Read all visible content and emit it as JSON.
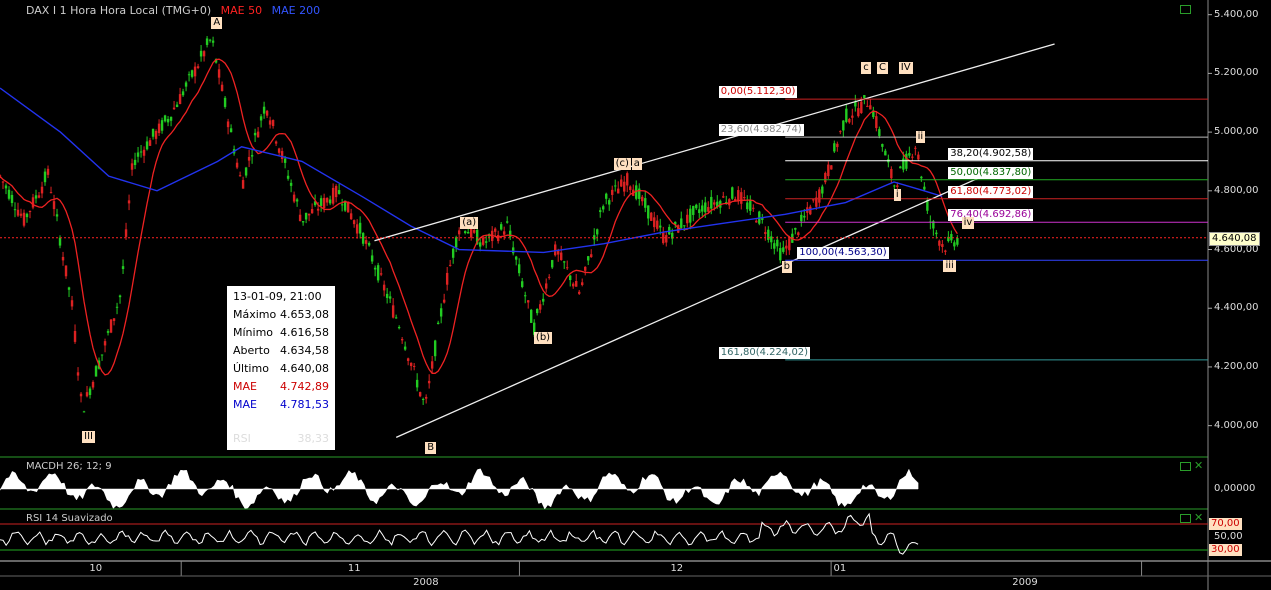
{
  "header": {
    "symbol_label": "DAX I 1 Hora Hora Local (TMG+0)",
    "mae50_label": "MAE 50",
    "mae200_label": "MAE 200",
    "colors": {
      "symbol": "#cccccc",
      "mae50": "#ff2222",
      "mae200": "#3355ff"
    }
  },
  "chart_data": {
    "type": "line",
    "main": {
      "yticks": [
        "5.400,00",
        "5.200,00",
        "5.000,00",
        "4.800,00",
        "4.600,00",
        "4.400,00",
        "4.200,00",
        "4.000,00"
      ],
      "ytick_values": [
        5400,
        5200,
        5000,
        4800,
        4600,
        4400,
        4200,
        4000
      ],
      "ylim": [
        3900,
        5450
      ],
      "last_price_label": "4.640,08",
      "last_price": 4640.08,
      "fibonacci": [
        {
          "label": "0,00(5.112,30)",
          "value": 5112.3,
          "color": "#cc2222",
          "text_bg": "#ffffff",
          "text_color": "#cc0000"
        },
        {
          "label": "23,60(4.982,74)",
          "value": 4982.74,
          "color": "#bbbbbb",
          "text_bg": "#ffffff",
          "text_color": "#888888"
        },
        {
          "label": "38,20(4.902,58)",
          "value": 4902.58,
          "color": "#ffffff",
          "text_bg": "#ffffff",
          "text_color": "#000000"
        },
        {
          "label": "50,00(4.837,80)",
          "value": 4837.8,
          "color": "#22aa22",
          "text_bg": "#ffffff",
          "text_color": "#006600"
        },
        {
          "label": "61,80(4.773,02)",
          "value": 4773.02,
          "color": "#cc2222",
          "text_bg": "#ffffff",
          "text_color": "#cc0000"
        },
        {
          "label": "76,40(4.692,86)",
          "value": 4692.86,
          "color": "#cc33cc",
          "text_bg": "#ffffff",
          "text_color": "#990099"
        },
        {
          "label": "100,00(4.563,30)",
          "value": 4563.3,
          "color": "#3344ff",
          "text_bg": "#ffffff",
          "text_color": "#000088"
        },
        {
          "label": "161,80(4.224,02)",
          "value": 4224.02,
          "color": "#339999",
          "text_bg": "#ffffff",
          "text_color": "#336666"
        }
      ],
      "wave_labels": [
        {
          "text": "A",
          "x": 0.175,
          "value": 5370
        },
        {
          "text": "III",
          "x": 0.068,
          "value": 3960
        },
        {
          "text": "B",
          "x": 0.352,
          "value": 3925
        },
        {
          "text": "(a)",
          "x": 0.381,
          "value": 4690
        },
        {
          "text": "(b)",
          "x": 0.442,
          "value": 4300
        },
        {
          "text": "(c)",
          "x": 0.508,
          "value": 4890
        },
        {
          "text": "a",
          "x": 0.523,
          "value": 4890
        },
        {
          "text": "b",
          "x": 0.647,
          "value": 4540
        },
        {
          "text": "c",
          "x": 0.713,
          "value": 5220
        },
        {
          "text": "C",
          "x": 0.726,
          "value": 5220
        },
        {
          "text": "IV",
          "x": 0.744,
          "value": 5220
        },
        {
          "text": "i",
          "x": 0.74,
          "value": 4785
        },
        {
          "text": "ii",
          "x": 0.758,
          "value": 4985
        },
        {
          "text": "iii",
          "x": 0.781,
          "value": 4545
        },
        {
          "text": "iv",
          "x": 0.796,
          "value": 4690
        }
      ]
    },
    "macd": {
      "label": "MACDH 26; 12; 9",
      "ytick": "0,00000"
    },
    "rsi": {
      "label": "RSI 14 Suavizado",
      "upper": "70,00",
      "mid": "50,00",
      "lower": "30,00"
    },
    "xaxis": {
      "months": [
        {
          "text": "10",
          "x": 0.074
        },
        {
          "text": "11",
          "x": 0.288
        },
        {
          "text": "12",
          "x": 0.555
        },
        {
          "text": "01",
          "x": 0.69
        }
      ],
      "years": [
        {
          "text": "2008",
          "x": 0.342
        },
        {
          "text": "2009",
          "x": 0.838
        }
      ]
    }
  },
  "infobox": {
    "datetime": "13-01-09, 21:00",
    "rows": [
      {
        "key": "Máximo",
        "value": "4.653,08",
        "color": "#000000"
      },
      {
        "key": "Mínimo",
        "value": "4.616,58",
        "color": "#000000"
      },
      {
        "key": "Aberto",
        "value": "4.634,58",
        "color": "#000000"
      },
      {
        "key": "Último",
        "value": "4.640,08",
        "color": "#000000"
      },
      {
        "key": "MAE",
        "value": "4.742,89",
        "color": "#cc0000"
      },
      {
        "key": "MAE",
        "value": "4.781,53",
        "color": "#0000cc"
      }
    ],
    "faded_key": "RSI",
    "faded_value": "38,33"
  }
}
